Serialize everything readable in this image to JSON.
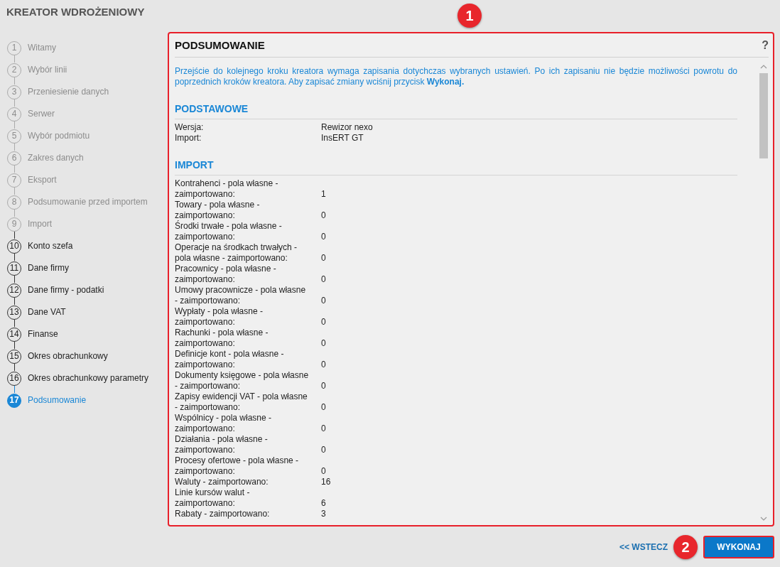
{
  "wizard": {
    "title": "KREATOR WDROŻENIOWY"
  },
  "steps": [
    {
      "number": "1",
      "label": "Witamy",
      "disabled": true,
      "selected": false
    },
    {
      "number": "2",
      "label": "Wybór linii",
      "disabled": true,
      "selected": false
    },
    {
      "number": "3",
      "label": "Przeniesienie danych",
      "disabled": true,
      "selected": false
    },
    {
      "number": "4",
      "label": "Serwer",
      "disabled": true,
      "selected": false
    },
    {
      "number": "5",
      "label": "Wybór podmiotu",
      "disabled": true,
      "selected": false
    },
    {
      "number": "6",
      "label": "Zakres danych",
      "disabled": true,
      "selected": false
    },
    {
      "number": "7",
      "label": "Eksport",
      "disabled": true,
      "selected": false
    },
    {
      "number": "8",
      "label": "Podsumowanie przed importem",
      "disabled": true,
      "selected": false
    },
    {
      "number": "9",
      "label": "Import",
      "disabled": true,
      "selected": false
    },
    {
      "number": "10",
      "label": "Konto szefa",
      "disabled": false,
      "selected": false
    },
    {
      "number": "11",
      "label": "Dane firmy",
      "disabled": false,
      "selected": false
    },
    {
      "number": "12",
      "label": "Dane firmy - podatki",
      "disabled": false,
      "selected": false
    },
    {
      "number": "13",
      "label": "Dane VAT",
      "disabled": false,
      "selected": false
    },
    {
      "number": "14",
      "label": "Finanse",
      "disabled": false,
      "selected": false
    },
    {
      "number": "15",
      "label": "Okres obrachunkowy",
      "disabled": false,
      "selected": false
    },
    {
      "number": "16",
      "label": "Okres obrachunkowy parametry",
      "disabled": false,
      "selected": false
    },
    {
      "number": "17",
      "label": "Podsumowanie",
      "disabled": false,
      "selected": true
    }
  ],
  "panel": {
    "title": "PODSUMOWANIE",
    "help": "?",
    "notice": "Przejście do kolejnego kroku kreatora wymaga zapisania dotychczas wybranych ustawień. Po ich zapisaniu nie będzie możliwości powrotu do poprzednich kroków kreatora. Aby zapisać zmiany wciśnij przycisk **Wykonaj.**",
    "sections": [
      {
        "title": "PODSTAWOWE",
        "rows": [
          {
            "label": "Wersja:",
            "value": "Rewizor nexo"
          },
          {
            "label": "Import:",
            "value": "InsERT GT"
          }
        ]
      },
      {
        "title": "IMPORT",
        "rows": [
          {
            "label": "Kontrahenci - pola własne - zaimportowano:",
            "value": "1"
          },
          {
            "label": "Towary - pola własne - zaimportowano:",
            "value": "0"
          },
          {
            "label": "Środki trwałe - pola własne - zaimportowano:",
            "value": "0"
          },
          {
            "label": "Operacje na środkach trwałych - pola własne - zaimportowano:",
            "value": "0"
          },
          {
            "label": "Pracownicy - pola własne - zaimportowano:",
            "value": "0"
          },
          {
            "label": "Umowy pracownicze - pola własne - zaimportowano:",
            "value": "0"
          },
          {
            "label": "Wypłaty - pola własne - zaimportowano:",
            "value": "0"
          },
          {
            "label": "Rachunki - pola własne - zaimportowano:",
            "value": "0"
          },
          {
            "label": "Definicje kont - pola własne - zaimportowano:",
            "value": "0"
          },
          {
            "label": "Dokumenty księgowe - pola własne - zaimportowano:",
            "value": "0"
          },
          {
            "label": "Zapisy ewidencji VAT - pola własne - zaimportowano:",
            "value": "0"
          },
          {
            "label": "Wspólnicy - pola własne - zaimportowano:",
            "value": "0"
          },
          {
            "label": "Działania - pola własne - zaimportowano:",
            "value": "0"
          },
          {
            "label": "Procesy ofertowe - pola własne - zaimportowano:",
            "value": "0"
          },
          {
            "label": "Waluty - zaimportowano:",
            "value": "16"
          },
          {
            "label": "Linie kursów walut - zaimportowano:",
            "value": "6"
          },
          {
            "label": "Rabaty - zaimportowano:",
            "value": "3"
          }
        ]
      }
    ]
  },
  "callouts": [
    {
      "number": "1"
    },
    {
      "number": "2"
    }
  ],
  "buttons": {
    "back": "<< WSTECZ",
    "execute": "WYKONAJ"
  }
}
